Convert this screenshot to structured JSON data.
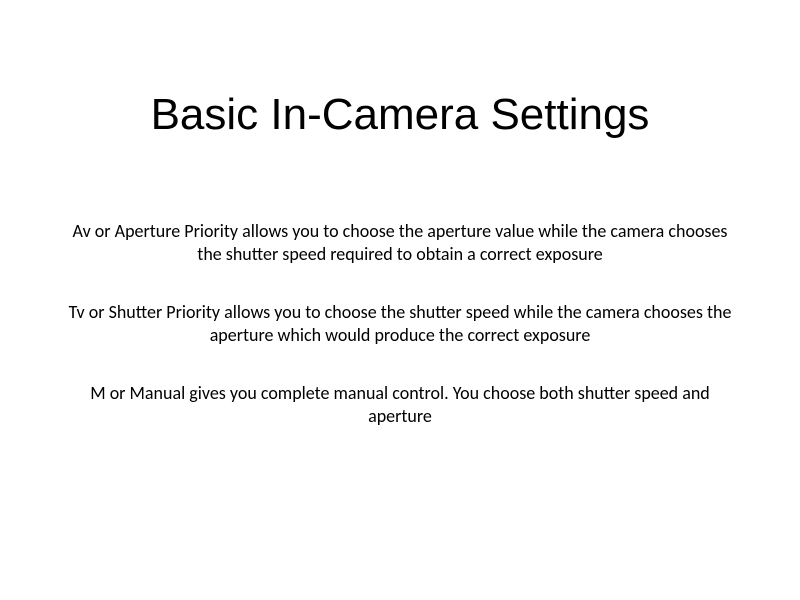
{
  "slide": {
    "title": "Basic In-Camera Settings",
    "paragraphs": [
      "Av or Aperture Priority allows you to choose the aperture value while the camera chooses the shutter speed required to obtain a correct exposure",
      "Tv or Shutter Priority allows you to choose the shutter speed while the camera chooses the aperture which would produce the correct exposure",
      "M or Manual gives you complete manual control.  You choose both shutter speed and aperture"
    ]
  }
}
